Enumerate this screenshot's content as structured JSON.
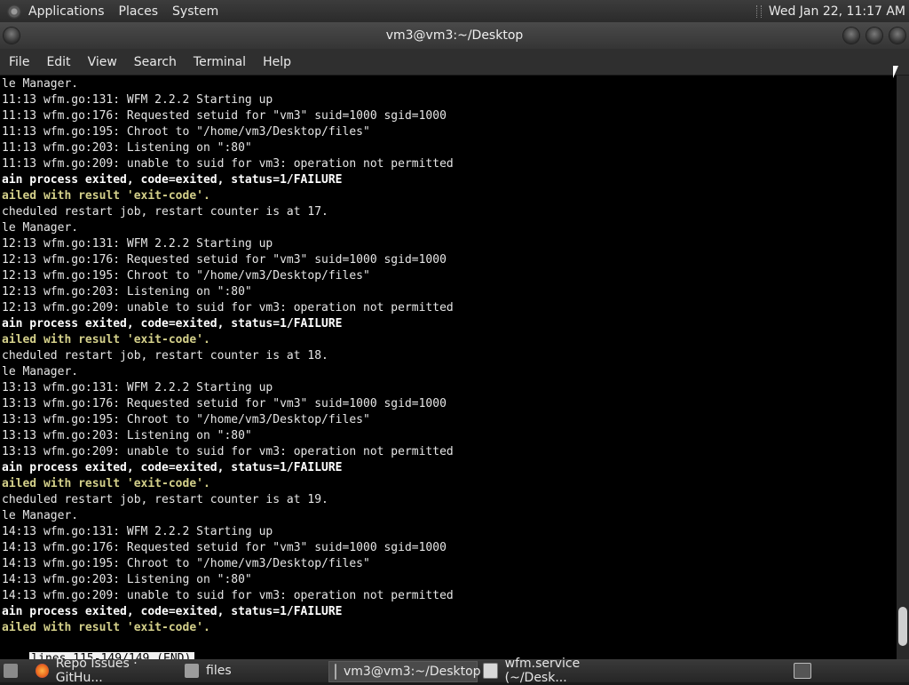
{
  "top_panel": {
    "menus": [
      "Applications",
      "Places",
      "System"
    ],
    "clock": "Wed Jan 22, 11:17 AM"
  },
  "window": {
    "title": "vm3@vm3:~/Desktop"
  },
  "menubar": [
    "File",
    "Edit",
    "View",
    "Search",
    "Terminal",
    "Help"
  ],
  "terminal": {
    "lines": [
      {
        "text": "le Manager.",
        "style": "normal"
      },
      {
        "text": "11:13 wfm.go:131: WFM 2.2.2 Starting up",
        "style": "normal"
      },
      {
        "text": "11:13 wfm.go:176: Requested setuid for \"vm3\" suid=1000 sgid=1000",
        "style": "normal"
      },
      {
        "text": "11:13 wfm.go:195: Chroot to \"/home/vm3/Desktop/files\"",
        "style": "normal"
      },
      {
        "text": "11:13 wfm.go:203: Listening on \":80\"",
        "style": "normal"
      },
      {
        "text": "11:13 wfm.go:209: unable to suid for vm3: operation not permitted",
        "style": "normal"
      },
      {
        "text": "ain process exited, code=exited, status=1/FAILURE",
        "style": "bold"
      },
      {
        "text": "ailed with result 'exit-code'.",
        "style": "yellow"
      },
      {
        "text": "cheduled restart job, restart counter is at 17.",
        "style": "normal"
      },
      {
        "text": "le Manager.",
        "style": "normal"
      },
      {
        "text": "12:13 wfm.go:131: WFM 2.2.2 Starting up",
        "style": "normal"
      },
      {
        "text": "12:13 wfm.go:176: Requested setuid for \"vm3\" suid=1000 sgid=1000",
        "style": "normal"
      },
      {
        "text": "12:13 wfm.go:195: Chroot to \"/home/vm3/Desktop/files\"",
        "style": "normal"
      },
      {
        "text": "12:13 wfm.go:203: Listening on \":80\"",
        "style": "normal"
      },
      {
        "text": "12:13 wfm.go:209: unable to suid for vm3: operation not permitted",
        "style": "normal"
      },
      {
        "text": "ain process exited, code=exited, status=1/FAILURE",
        "style": "bold"
      },
      {
        "text": "ailed with result 'exit-code'.",
        "style": "yellow"
      },
      {
        "text": "cheduled restart job, restart counter is at 18.",
        "style": "normal"
      },
      {
        "text": "le Manager.",
        "style": "normal"
      },
      {
        "text": "13:13 wfm.go:131: WFM 2.2.2 Starting up",
        "style": "normal"
      },
      {
        "text": "13:13 wfm.go:176: Requested setuid for \"vm3\" suid=1000 sgid=1000",
        "style": "normal"
      },
      {
        "text": "13:13 wfm.go:195: Chroot to \"/home/vm3/Desktop/files\"",
        "style": "normal"
      },
      {
        "text": "13:13 wfm.go:203: Listening on \":80\"",
        "style": "normal"
      },
      {
        "text": "13:13 wfm.go:209: unable to suid for vm3: operation not permitted",
        "style": "normal"
      },
      {
        "text": "ain process exited, code=exited, status=1/FAILURE",
        "style": "bold"
      },
      {
        "text": "ailed with result 'exit-code'.",
        "style": "yellow"
      },
      {
        "text": "cheduled restart job, restart counter is at 19.",
        "style": "normal"
      },
      {
        "text": "le Manager.",
        "style": "normal"
      },
      {
        "text": "14:13 wfm.go:131: WFM 2.2.2 Starting up",
        "style": "normal"
      },
      {
        "text": "14:13 wfm.go:176: Requested setuid for \"vm3\" suid=1000 sgid=1000",
        "style": "normal"
      },
      {
        "text": "14:13 wfm.go:195: Chroot to \"/home/vm3/Desktop/files\"",
        "style": "normal"
      },
      {
        "text": "14:13 wfm.go:203: Listening on \":80\"",
        "style": "normal"
      },
      {
        "text": "14:13 wfm.go:209: unable to suid for vm3: operation not permitted",
        "style": "normal"
      },
      {
        "text": "ain process exited, code=exited, status=1/FAILURE",
        "style": "bold"
      },
      {
        "text": "ailed with result 'exit-code'.",
        "style": "yellow"
      }
    ],
    "status": "lines 115-149/149 (END)"
  },
  "taskbar": {
    "tasks": [
      {
        "label": "Repo Issues · GitHu...",
        "icon": "firefox-icon"
      },
      {
        "label": "files",
        "icon": "folder-icon"
      },
      {
        "label": "vm3@vm3:~/Desktop",
        "icon": "terminal-icon",
        "active": true
      },
      {
        "label": "wfm.service (~/Desk...",
        "icon": "text-editor-icon"
      }
    ]
  },
  "colors": {
    "terminal_bg": "#000000",
    "terminal_fg": "#e6e6e6",
    "highlight_yellow": "#d4d08a"
  }
}
